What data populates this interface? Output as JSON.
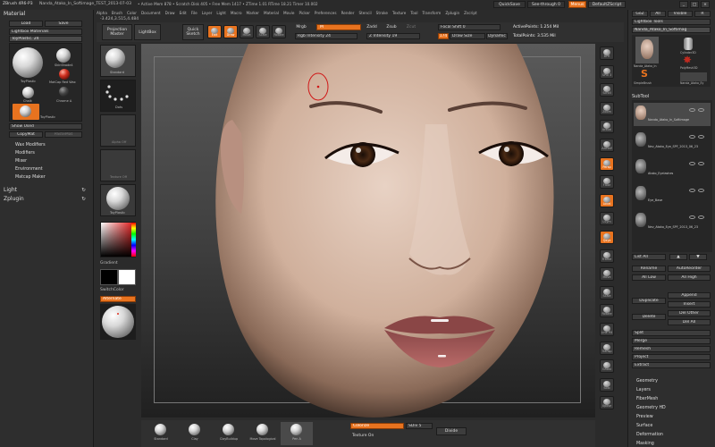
{
  "titlebar": {
    "app": "ZBrush 4R6-P3",
    "project": "Nanda_Atako_In_Softimage_TEST_2013-07-03",
    "stats": "• Active Mem 878 • Scratch Disk 405 • Free Mem 1417 • ZTime 1.01 RTime 18.21 Timer 10.002",
    "quicksave": "QuickSave",
    "seethrough": "See-through  0",
    "menus_btn": "Menus",
    "script_btn": "DefaultZScript"
  },
  "menubar": [
    "Alpha",
    "Brush",
    "Color",
    "Document",
    "Draw",
    "Edit",
    "File",
    "Layer",
    "Light",
    "Macro",
    "Marker",
    "Material",
    "Movie",
    "Picker",
    "Preferences",
    "Render",
    "Stencil",
    "Stroke",
    "Texture",
    "Tool",
    "Transform",
    "Zplugin",
    "Zscript"
  ],
  "coords": "-3.424,3.515,4.484",
  "left_panel": {
    "header": "Material",
    "load": "Load",
    "save": "Save",
    "lightbox_materials": "Lightbox Materials",
    "current_material": "ToyPlastic. 24",
    "mat_labels": [
      "ToyPlastic",
      "SkinShade4",
      "MatCap Red Wax",
      "Chalk",
      "Chrome A",
      "ToyPlastic"
    ],
    "show_used": "Show Used",
    "copy_mat": "CopyMat",
    "paste_mat": "PasteMat",
    "subsections": [
      "Wax Modifiers",
      "Modifiers",
      "Mixer",
      "Environment",
      "Matcap Maker"
    ],
    "light": "Light",
    "zplugin": "Zplugin"
  },
  "shelf": {
    "projection_master": "Projection Master",
    "lightbox": "LightBox",
    "quick_sketch": "Quick Sketch",
    "tools": [
      {
        "label": "Edit",
        "on": true
      },
      {
        "label": "Draw",
        "on": true
      },
      {
        "label": "Move",
        "on": false
      },
      {
        "label": "Scale",
        "on": false
      },
      {
        "label": "Rotate",
        "on": false
      }
    ],
    "mrgb": "Mrgb",
    "rgb": "Rgb",
    "m": "M",
    "zadd": "Zadd",
    "zsub": "Zsub",
    "zcut": "Zcut",
    "rgb_intensity": "Rgb Intensity 24",
    "z_intensity": "Z Intensity 19",
    "focal_shift": "Focal Shift 0",
    "draw_size": "Draw Size",
    "draw_size_value": "174",
    "dynamic": "Dynamic",
    "active_points": "ActivePoints: 1.254 Mil",
    "total_points": "TotalPoints: 3.535 Mil"
  },
  "left_tray": {
    "brush_label": "Standard",
    "stroke_label": "Dots",
    "alpha_label": "Alpha Off",
    "texture_label": "Texture Off",
    "material_label": "ToyPlastic",
    "gradient": "Gradient",
    "switch_color": "SwitchColor",
    "alternate": "Alternate"
  },
  "right_strip": [
    {
      "label": "BPR",
      "on": false
    },
    {
      "label": "SPix 3",
      "on": false
    },
    {
      "label": "Scroll",
      "on": false
    },
    {
      "label": "Zoom",
      "on": false
    },
    {
      "label": "Actual",
      "on": false
    },
    {
      "label": "AAHalf",
      "on": false
    },
    {
      "label": "Persp",
      "on": true
    },
    {
      "label": "Floor",
      "on": false
    },
    {
      "label": "Local",
      "on": true
    },
    {
      "label": "LSym",
      "on": false
    },
    {
      "label": "Qxyz",
      "on": true
    },
    {
      "label": "Frame",
      "on": false
    },
    {
      "label": "Move",
      "on": false
    },
    {
      "label": "Scale",
      "on": false
    },
    {
      "label": "Rotate",
      "on": false
    },
    {
      "label": "Line Fill",
      "on": false
    },
    {
      "label": "Transp",
      "on": false
    },
    {
      "label": "Ghost",
      "on": false
    },
    {
      "label": "Solo",
      "on": false
    },
    {
      "label": "Xpose",
      "on": false
    }
  ],
  "right_panel": {
    "top_buttons": [
      "GoZ",
      "All",
      "Visible",
      "R"
    ],
    "lightbox_tools": "Lightbox Tools",
    "current_tool": "Nanda_Atako_In_Softimag",
    "thumb_labels": [
      "Nanda_Atako_In",
      "Cylinder3D",
      "PolyMesh3D",
      "SimpleBrush",
      "Nanda_Atako_Ey"
    ],
    "subtool_header": "SubTool",
    "subtools": [
      "Nanda_Atako_In_Softimage",
      "Nev_Atako_Eye_SPF_2013_06_23",
      "Atako_Eyelashes",
      "Eye_Base",
      "Nev_Atako_Eye_SPF_2013_06_23"
    ],
    "list_all": "List All",
    "rename": "Rename",
    "autoreorder": "AutoReorder",
    "all_low": "All Low",
    "all_high": "All High",
    "duplicate": "Duplicate",
    "append": "Append",
    "insert": "Insert",
    "delete": "Delete",
    "del_other": "Del Other",
    "del_all": "Del All",
    "split": "Split",
    "merge": "Merge",
    "remesh": "Remesh",
    "project": "Project",
    "extract": "Extract",
    "sections": [
      "Geometry",
      "Layers",
      "FiberMesh",
      "Geometry HD",
      "Preview",
      "Surface",
      "Deformation",
      "Masking"
    ]
  },
  "bottom": {
    "brushes": [
      "Standard",
      "Clay",
      "ClayBuildup",
      "Move Topological",
      "Pen A"
    ],
    "colorize": "Colorize",
    "texture_on": "Texture On",
    "sdiv": "SDiv 5",
    "divide": "Divide"
  }
}
